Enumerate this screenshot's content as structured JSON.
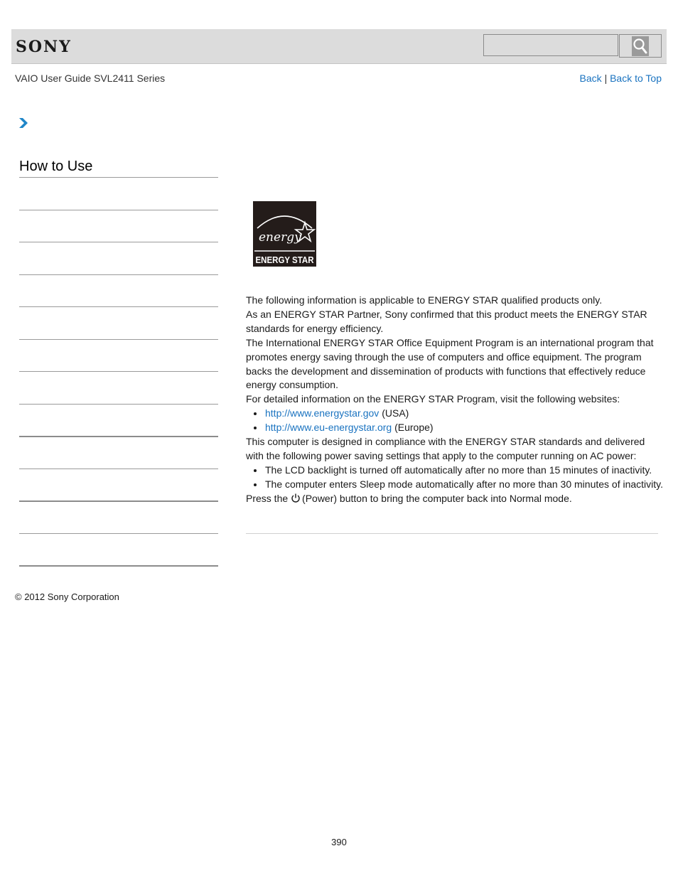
{
  "header": {
    "brand": "SONY",
    "search": {
      "value": "",
      "placeholder": ""
    },
    "search_button_icon": "search-icon"
  },
  "nav": {
    "guide_title": "VAIO User Guide SVL2411 Series",
    "back_label": "Back",
    "separator": "|",
    "back_to_top_label": "Back to Top",
    "link_color": "#1a73c0"
  },
  "sidebar": {
    "chevron_icon": "chevron-right-icon",
    "heading": "How to Use",
    "item_count": 12
  },
  "main": {
    "logo": {
      "script_text": "energy",
      "label": "ENERGY STAR"
    },
    "paragraphs": [
      "The following information is applicable to ENERGY STAR qualified products only.",
      "As an ENERGY STAR Partner, Sony confirmed that this product meets the ENERGY STAR standards for energy efficiency.",
      "The International ENERGY STAR Office Equipment Program is an international program that promotes energy saving through the use of computers and office equipment. The program backs the development and dissemination of products with functions that effectively reduce energy consumption.",
      "For detailed information on the ENERGY STAR Program, visit the following websites:"
    ],
    "websites": [
      {
        "url": "http://www.energystar.gov",
        "region": " (USA)"
      },
      {
        "url": "http://www.eu-energystar.org",
        "region": " (Europe)"
      }
    ],
    "compliance_text": "This computer is designed in compliance with the ENERGY STAR standards and delivered with the following power saving settings that apply to the computer running on AC power:",
    "settings": [
      "The LCD backlight is turned off automatically after no more than 15 minutes of inactivity.",
      "The computer enters Sleep mode automatically after no more than 30 minutes of inactivity."
    ],
    "power_text_before": "Press the ",
    "power_icon": "power-icon",
    "power_text_after": "(Power) button to bring the computer back into Normal mode."
  },
  "footer": {
    "copyright": "© 2012 Sony Corporation",
    "page_number": "390"
  }
}
